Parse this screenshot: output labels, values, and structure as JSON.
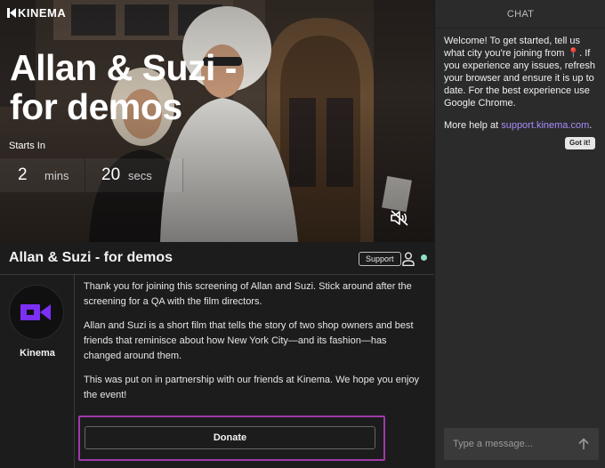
{
  "brand": {
    "name": "KINEMA"
  },
  "hero": {
    "title": "Allan & Suzi - for demos",
    "starts_in_label": "Starts In",
    "countdown": {
      "mins_value": "2",
      "mins_label": "mins",
      "secs_value": "20",
      "secs_label": "secs"
    },
    "mute_icon": "speaker-muted-icon"
  },
  "event": {
    "title": "Allan & Suzi - for demos",
    "support_label": "Support",
    "user_icon": "user-icon",
    "status_color": "#8fe0c4"
  },
  "organizer": {
    "name": "Kinema",
    "logo_icon": "camera-icon",
    "logo_color": "#7b2ff7"
  },
  "description": {
    "p1": "Thank you for joining this screening of Allan and Suzi.  Stick around after the screening for a QA with the film directors.",
    "p2": "Allan and Suzi is a short film that tells the story of two shop owners and best friends that reminisce about how New York City—and its fashion—has changed around them.",
    "p3": "This was put on in partnership with our friends at Kinema.  We hope you enjoy the event!"
  },
  "donate": {
    "label": "Donate",
    "highlight_color": "#a03aa8"
  },
  "chat": {
    "header": "CHAT",
    "welcome_part1": "Welcome! To get started, tell us what city you're joining from ",
    "pin_icon": "📍",
    "welcome_part2": ". If you experience any issues, refresh your browser and ensure it is up to date. For the best experience use Google Chrome.",
    "help_prefix": "More help at ",
    "help_link": "support.kinema.com",
    "help_suffix": ".",
    "got_it_label": "Got it!",
    "input_placeholder": "Type a message...",
    "send_icon": "arrow-up-icon",
    "link_color": "#a98cff"
  }
}
